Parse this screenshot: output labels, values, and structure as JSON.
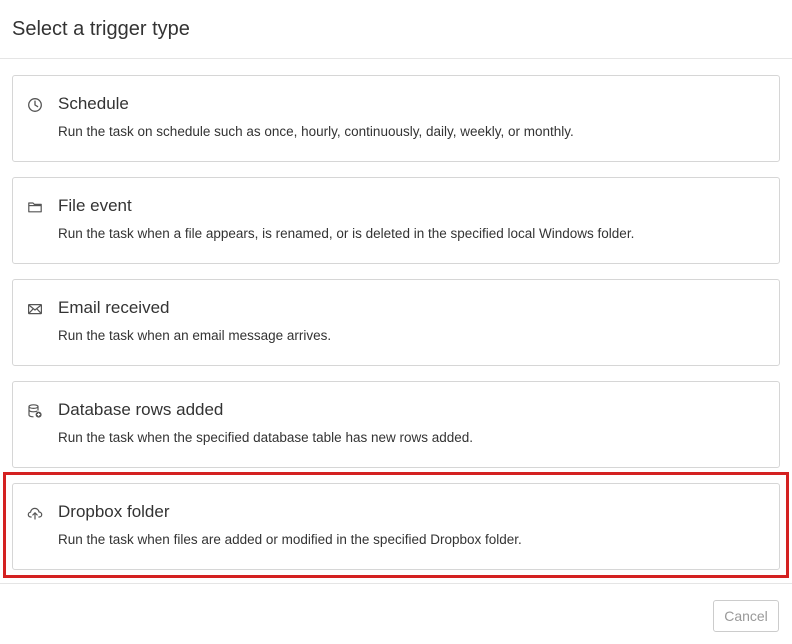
{
  "dialog": {
    "title": "Select a trigger type"
  },
  "options": [
    {
      "icon": "clock-icon",
      "title": "Schedule",
      "description": "Run the task on schedule such as once, hourly, continuously, daily, weekly, or monthly."
    },
    {
      "icon": "folder-icon",
      "title": "File event",
      "description": "Run the task when a file appears, is renamed, or is deleted in the specified local Windows folder."
    },
    {
      "icon": "envelope-icon",
      "title": "Email received",
      "description": "Run the task when an email message arrives."
    },
    {
      "icon": "database-add-icon",
      "title": "Database rows added",
      "description": "Run the task when the specified database table has new rows added."
    },
    {
      "icon": "cloud-upload-icon",
      "title": "Dropbox folder",
      "description": "Run the task when files are added or modified in the specified Dropbox folder."
    }
  ],
  "highlight": {
    "color": "#d42121",
    "target": "Dropbox folder"
  },
  "footer": {
    "cancel_label": "Cancel"
  }
}
